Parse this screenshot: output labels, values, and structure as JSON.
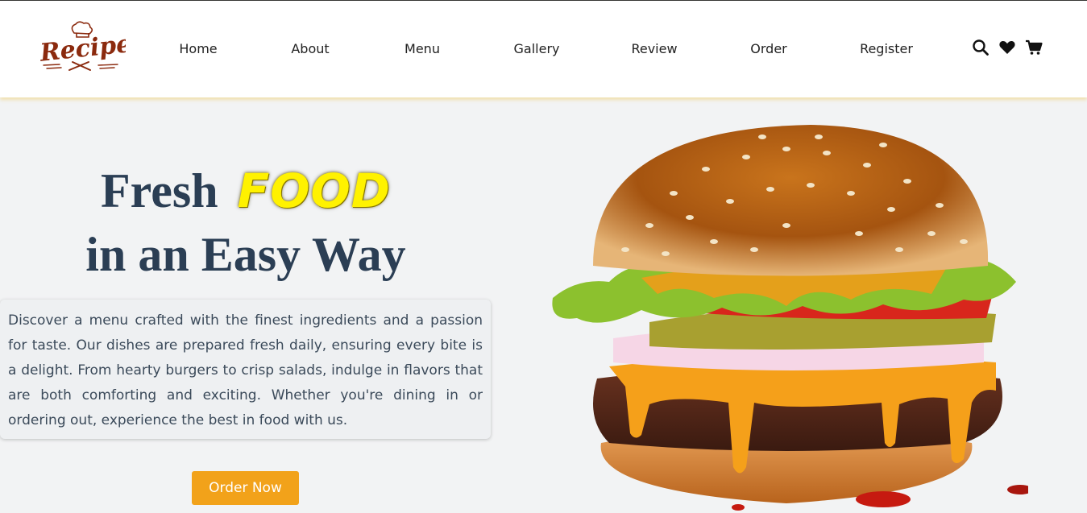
{
  "brand": {
    "logo_text": "Recipes"
  },
  "nav": {
    "items": [
      {
        "label": "Home"
      },
      {
        "label": "About"
      },
      {
        "label": "Menu"
      },
      {
        "label": "Gallery"
      },
      {
        "label": "Review"
      },
      {
        "label": "Order"
      },
      {
        "label": "Register"
      }
    ]
  },
  "header_icons": [
    "search-icon",
    "heart-icon",
    "cart-icon"
  ],
  "hero": {
    "title_word": "Fresh",
    "title_highlight": "FOOD",
    "subtitle": "in an Easy Way",
    "description": "Discover a menu crafted with the finest ingredients and a passion for taste. Our dishes are prepared fresh daily, ensuring every bite is a delight. From hearty burgers to crisp salads, indulge in flavors that are both comforting and exciting. Whether you're dining in or ordering out, experience the best in food with us.",
    "cta_label": "Order Now"
  },
  "colors": {
    "title": "#2b3e54",
    "highlight": "#fff200",
    "button": "#f2a21a",
    "logo": "#8b2a0e",
    "background": "#f2f3f4"
  }
}
